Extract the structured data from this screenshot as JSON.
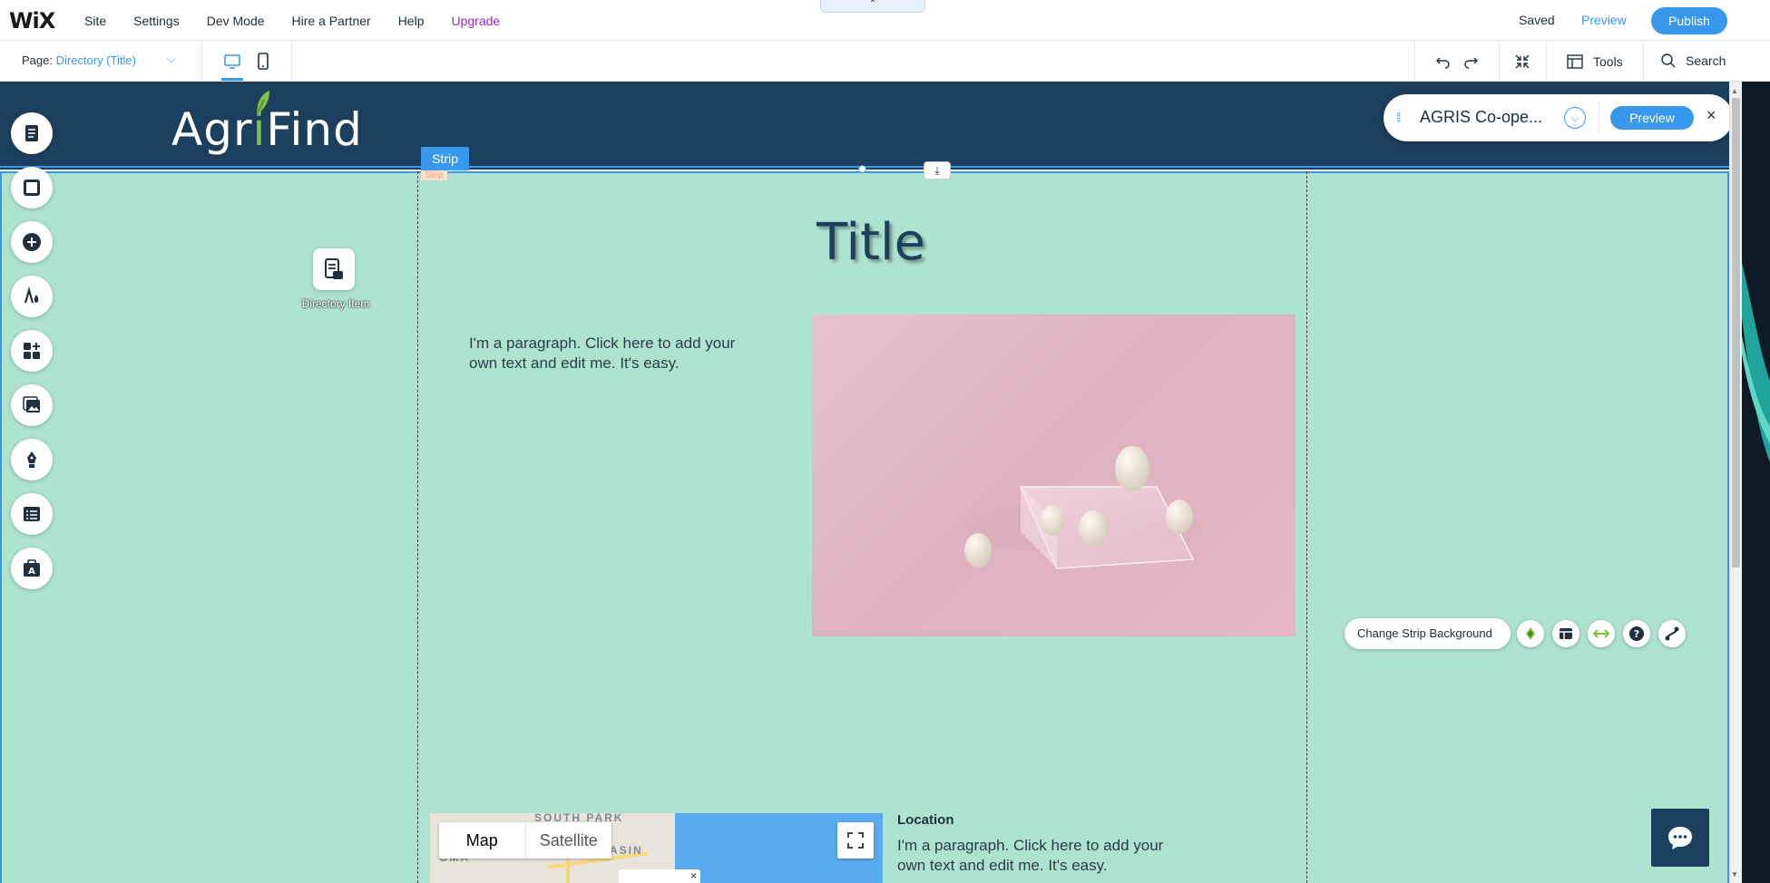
{
  "topbar": {
    "logo": "WiX",
    "menu": [
      "Site",
      "Settings",
      "Dev Mode",
      "Hire a Partner",
      "Help",
      "Upgrade"
    ],
    "collapse_glyph": "⌃",
    "saved": "Saved",
    "preview": "Preview",
    "publish": "Publish"
  },
  "pagebar": {
    "page_label": "Page:",
    "page_name": "Directory (Title)",
    "chevron": "⌵",
    "tools": "Tools",
    "search": "Search"
  },
  "site": {
    "brand_prefix": "Agr",
    "brand_i": "i",
    "brand_suffix": "Find",
    "strip_label": "Strip",
    "strip_mini": "Strip",
    "title": "Title",
    "paragraph": "I'm a paragraph. Click here to add your own text and edit me. It's easy.",
    "directory_item": "Directory Item",
    "location_title": "Location",
    "location_paragraph": "I'm a paragraph. Click here to add your own text and edit me. It's easy."
  },
  "dataset_panel": {
    "grip": "⁞⁞",
    "name": "AGRIS Co-ope...",
    "chevron": "⌵",
    "preview": "Preview",
    "close": "×"
  },
  "strip_actions": {
    "change_bg": "Change Strip Background",
    "help": "?"
  },
  "map": {
    "tab_map": "Map",
    "tab_satellite": "Satellite",
    "district_1": "SOUTH PARK",
    "district_2": "ASIN",
    "district_3": "OMA",
    "card_close": "×"
  },
  "left_tools": [
    "pages-icon",
    "background-icon",
    "add-icon",
    "design-icon",
    "app-market-icon",
    "media-icon",
    "blog-icon",
    "cms-icon",
    "portfolio-icon"
  ],
  "colors": {
    "accent": "#3899ec",
    "header_navy": "#1d3f5e",
    "strip_mint": "#aee3d0",
    "upgrade_purple": "#9a27d5",
    "leaf_green": "#7dc242"
  }
}
